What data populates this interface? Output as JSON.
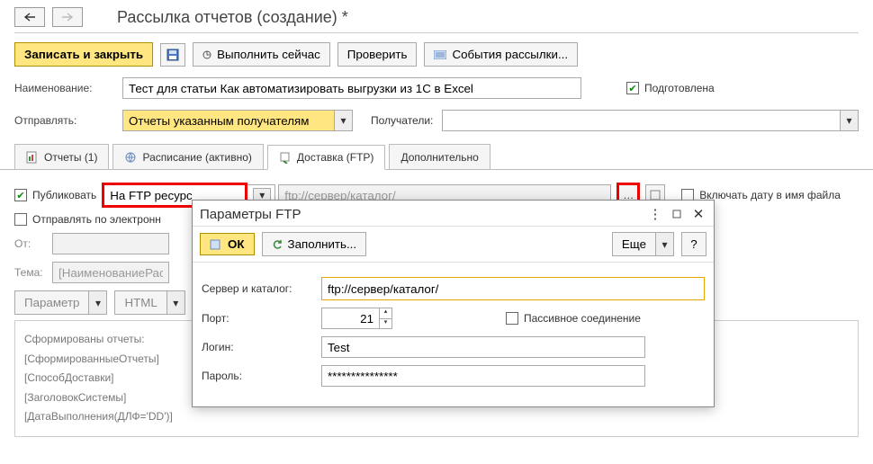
{
  "header": {
    "title": "Рассылка отчетов (создание) *"
  },
  "toolbar": {
    "record_close": "Записать и закрыть",
    "run_now": "Выполнить сейчас",
    "check": "Проверить",
    "events": "События рассылки..."
  },
  "form": {
    "name_label": "Наименование:",
    "name_value": "Тест для статьи Как автоматизировать выгрузки из 1С в Excel",
    "prepared": "Подготовлена",
    "send_label": "Отправлять:",
    "send_value": "Отчеты указанным получателям",
    "recipients_label": "Получатели:"
  },
  "tabs": {
    "reports": "Отчеты (1)",
    "schedule": "Расписание (активно)",
    "delivery": "Доставка (FTP)",
    "extra": "Дополнительно"
  },
  "delivery": {
    "publish": "Публиковать",
    "publish_target": "На FTP ресурс",
    "ftp_placeholder": "ftp://сервер/каталог/",
    "include_date": "Включать дату в имя файла",
    "send_email": "Отправлять по электронн",
    "from_label": "От:",
    "subject_label": "Тема:",
    "subject_placeholder": "[НаименованиеРассылк",
    "param_btn": "Параметр",
    "html_btn": "HTML",
    "tmpl_lines": [
      "Сформированы отчеты:",
      "[СформированныеОтчеты]",
      "[СпособДоставки]",
      "[ЗаголовокСистемы]",
      "[ДатаВыполнения(ДЛФ='DD')]"
    ]
  },
  "ftp_dialog": {
    "title": "Параметры FTP",
    "ok": "ОК",
    "fill": "Заполнить...",
    "more": "Еще",
    "help": "?",
    "server_label": "Сервер и каталог:",
    "server_value": "ftp://сервер/каталог/",
    "port_label": "Порт:",
    "port_value": "21",
    "passive": "Пассивное соединение",
    "login_label": "Логин:",
    "login_value": "Test",
    "password_label": "Пароль:",
    "password_value": "***************"
  }
}
